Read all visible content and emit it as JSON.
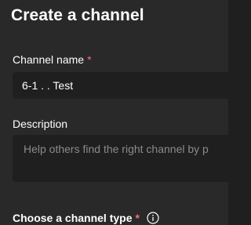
{
  "dialog": {
    "title": "Create a channel"
  },
  "channel_name": {
    "label": "Channel name",
    "required_mark": "*",
    "value": "6-1 . . Test"
  },
  "description": {
    "label": "Description",
    "placeholder": "Help others find the right channel by p"
  },
  "channel_type": {
    "label": "Choose a channel type",
    "required_mark": "*",
    "info_icon": "info-icon"
  },
  "colors": {
    "background": "#292929",
    "input_background": "#1f1f1f",
    "required": "#f1707b",
    "placeholder": "#8a8a8a"
  }
}
